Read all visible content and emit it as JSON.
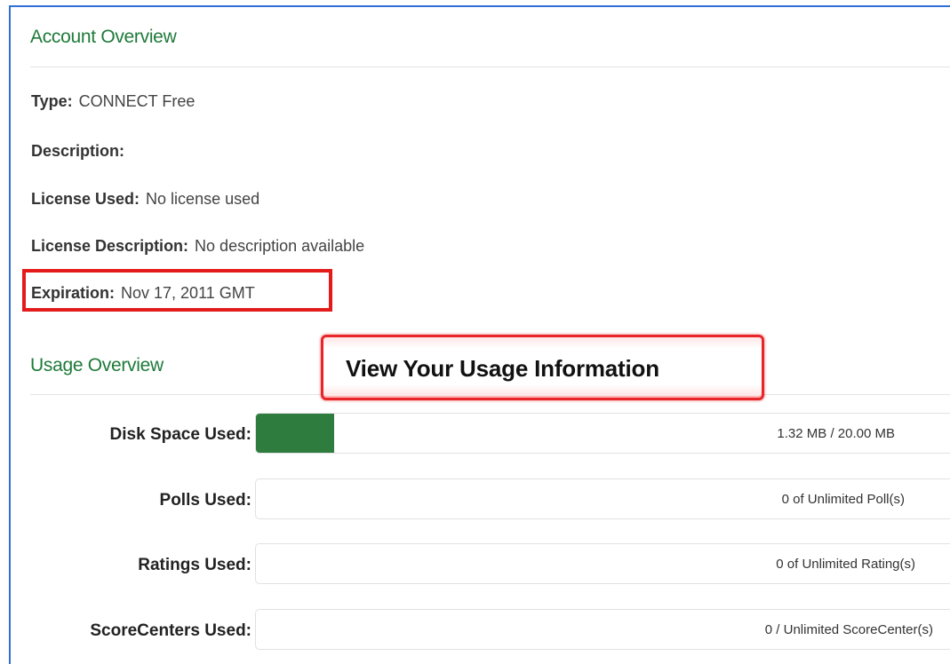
{
  "account": {
    "title": "Account Overview",
    "fields": [
      {
        "label": "Type:",
        "value": "CONNECT Free"
      },
      {
        "label": "Description:",
        "value": ""
      },
      {
        "label": "License Used:",
        "value": "No license used"
      },
      {
        "label": "License Description:",
        "value": "No description available"
      },
      {
        "label": "Expiration:",
        "value": "Nov 17, 2011 GMT"
      }
    ]
  },
  "callout": {
    "text": "View Your Usage Information"
  },
  "usage": {
    "title": "Usage Overview",
    "rows": [
      {
        "label": "Disk Space Used:",
        "text": "1.32 MB / 20.00 MB",
        "fill_fraction": 0.066
      },
      {
        "label": "Polls Used:",
        "text": "0 of Unlimited Poll(s)",
        "fill_fraction": 0
      },
      {
        "label": "Ratings Used:",
        "text": "0 of Unlimited Rating(s)",
        "fill_fraction": 0
      },
      {
        "label": "ScoreCenters Used:",
        "text": "0 / Unlimited ScoreCenter(s)",
        "fill_fraction": 0
      }
    ]
  },
  "colors": {
    "section_title": "#1f7a3a",
    "bar_fill": "#2e7d3f",
    "highlight": "#e31b1b",
    "frame": "#2f6fd6"
  }
}
